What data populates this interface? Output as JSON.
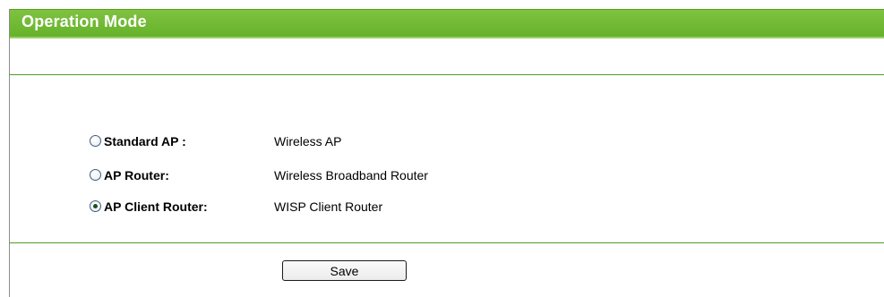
{
  "page": {
    "title": "Operation Mode"
  },
  "options": [
    {
      "label": "Standard AP :",
      "description": "Wireless AP",
      "selected": false
    },
    {
      "label": "AP Router:",
      "description": "Wireless Broadband Router",
      "selected": false
    },
    {
      "label": "AP Client Router:",
      "description": "WISP Client Router",
      "selected": true
    }
  ],
  "actions": {
    "save_label": "Save"
  },
  "colors": {
    "title_bar": "#6cb82f",
    "divider": "#4b9d2a"
  }
}
